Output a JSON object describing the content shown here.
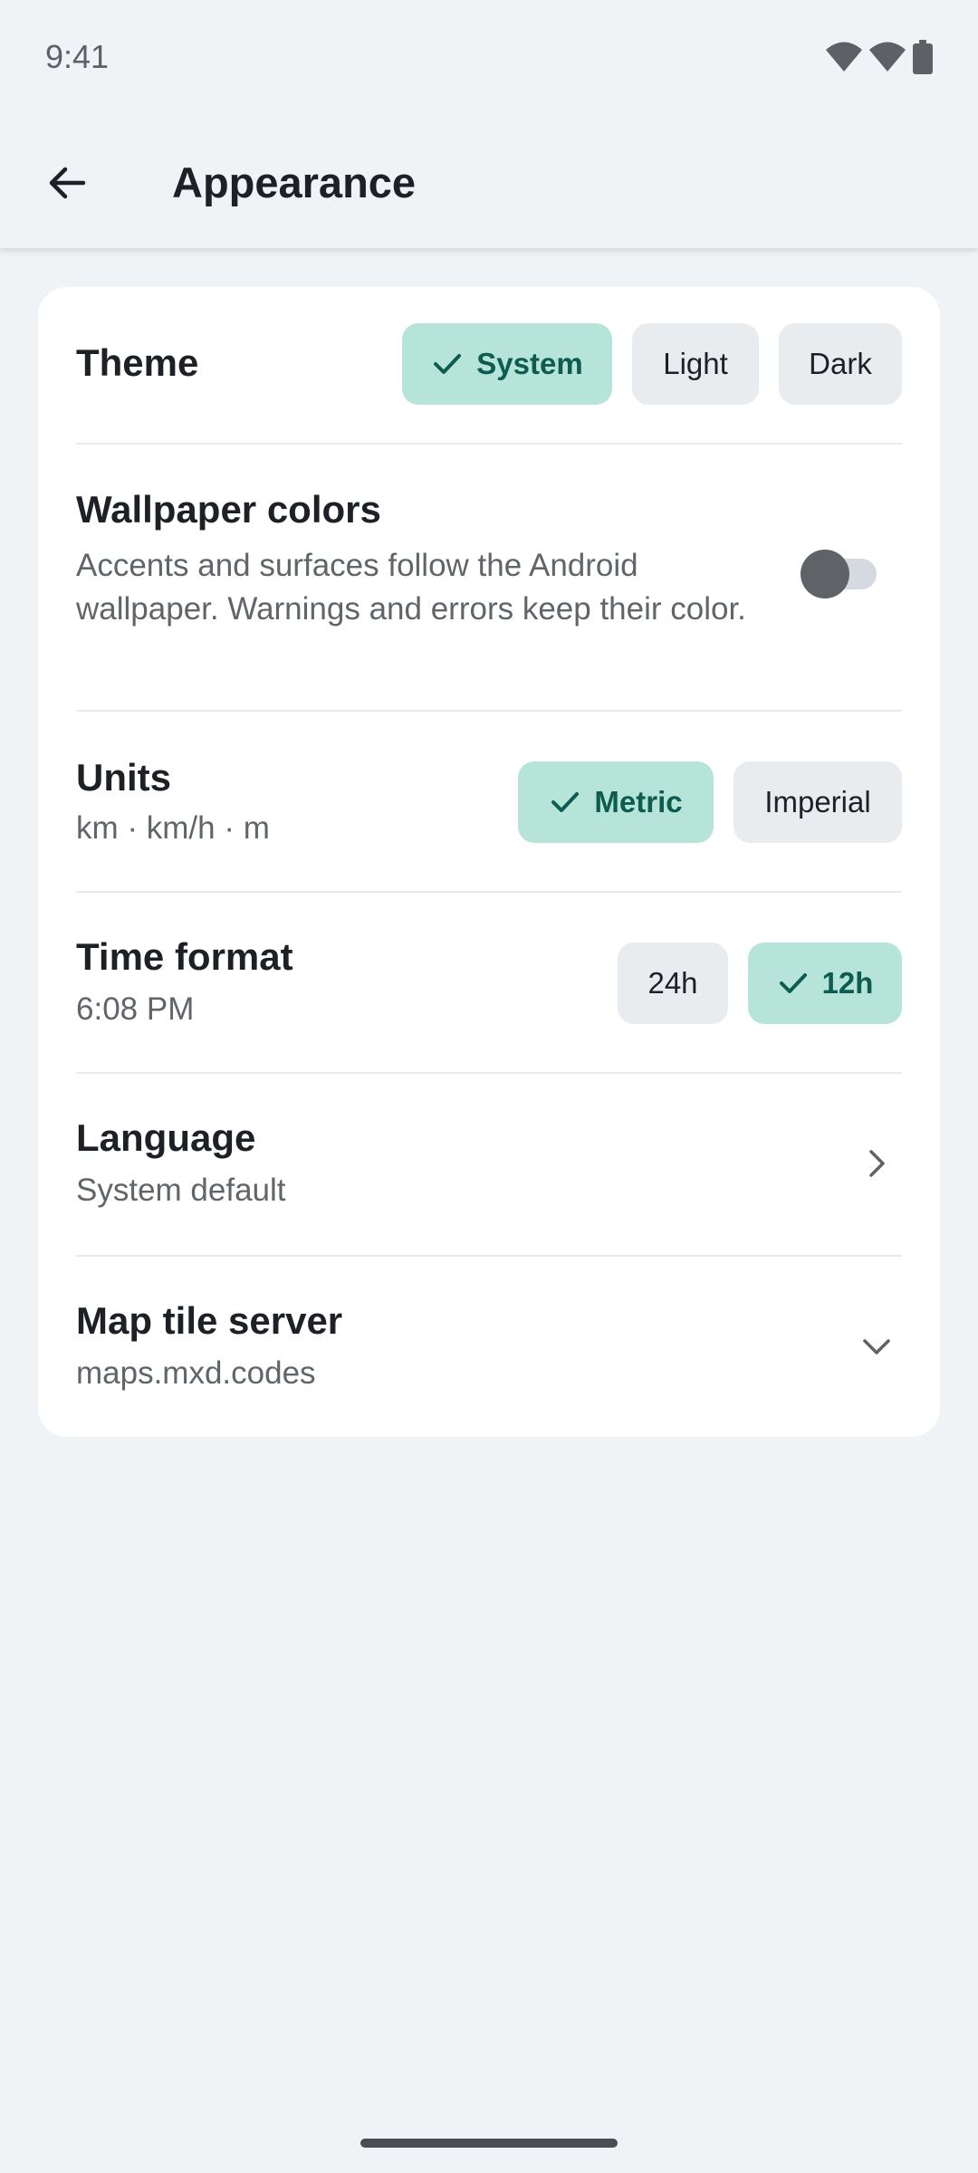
{
  "status_bar": {
    "time": "9:41",
    "icons": [
      "wifi-icon",
      "wifi-icon",
      "battery-icon"
    ]
  },
  "app_bar": {
    "back_icon": "arrow-back-icon",
    "title": "Appearance"
  },
  "colors": {
    "background": "#eff3f6",
    "card": "#ffffff",
    "chip_selected_bg": "#b6e4d9",
    "chip_selected_text": "#0e5c4f",
    "chip_bg": "#e9ecef",
    "secondary_text": "#60656a"
  },
  "settings": {
    "theme": {
      "title": "Theme",
      "options": [
        {
          "label": "System",
          "selected": true
        },
        {
          "label": "Light",
          "selected": false
        },
        {
          "label": "Dark",
          "selected": false
        }
      ]
    },
    "wallpaper": {
      "title": "Wallpaper colors",
      "description": "Accents and surfaces follow the Android wallpaper. Warnings and errors keep their color.",
      "enabled": false
    },
    "units": {
      "title": "Units",
      "subtitle": "km · km/h · m",
      "options": [
        {
          "label": "Metric",
          "selected": true
        },
        {
          "label": "Imperial",
          "selected": false
        }
      ]
    },
    "time_format": {
      "title": "Time format",
      "subtitle": "6:08 PM",
      "options": [
        {
          "label": "24h",
          "selected": false
        },
        {
          "label": "12h",
          "selected": true
        }
      ]
    },
    "language": {
      "title": "Language",
      "subtitle": "System default",
      "icon": "chevron-right-icon"
    },
    "map_tile_server": {
      "title": "Map tile server",
      "subtitle": "maps.mxd.codes",
      "icon": "chevron-down-icon"
    }
  }
}
